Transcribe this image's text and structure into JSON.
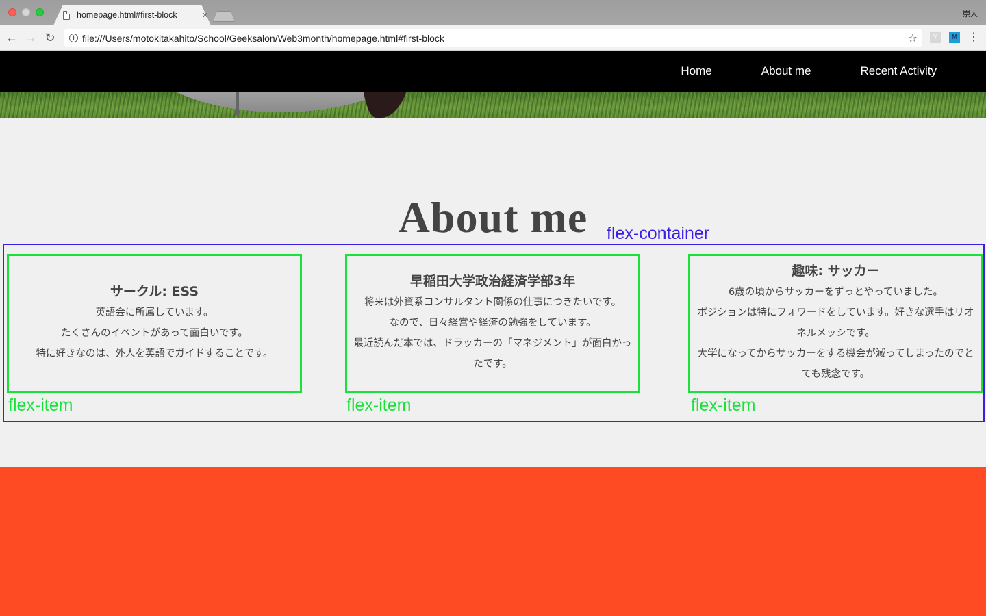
{
  "browser": {
    "tab_title": "homepage.html#first-block",
    "tab_close": "×",
    "url": "file:///Users/motokitakahito/School/Geeksalon/Web3month/homepage.html#first-block",
    "profile_name": "崇人",
    "ext_y": "Y",
    "ext_m": "M",
    "icons": [
      "back-icon",
      "forward-icon",
      "reload-icon",
      "info-icon",
      "star-icon",
      "menu-icon"
    ]
  },
  "site_nav": {
    "links": [
      "Home",
      "About me",
      "Recent Activity"
    ]
  },
  "section": {
    "title": "About me"
  },
  "annotations": {
    "container_label": "flex-container",
    "item_label": "flex-item"
  },
  "items": [
    {
      "heading": "サークル: ESS",
      "lines": [
        "英語会に所属しています。",
        "たくさんのイベントがあって面白いです。",
        "特に好きなのは、外人を英語でガイドすることです。"
      ]
    },
    {
      "heading": "早稲田大学政治経済学部3年",
      "lines": [
        "将来は外資系コンサルタント関係の仕事につきたいです。",
        "なので、日々経営や経済の勉強をしています。",
        "最近読んだ本では、ドラッカーの「マネジメント」が面白かっ",
        "たです。"
      ]
    },
    {
      "heading": "趣味: サッカー",
      "lines": [
        "6歳の頃からサッカーをずっとやっていました。",
        "ポジションは特にフォワードをしています。好きな選手はリオ",
        "ネルメッシです。",
        "大学になってからサッカーをする機会が減ってしまったのでと",
        "ても残念です。"
      ]
    }
  ],
  "colors": {
    "nav_bg": "#000000",
    "page_bg": "#f0f0f0",
    "bottom_block": "#ff4b24",
    "container_outline": "#3b1ee6",
    "item_outline": "#19e23a"
  }
}
